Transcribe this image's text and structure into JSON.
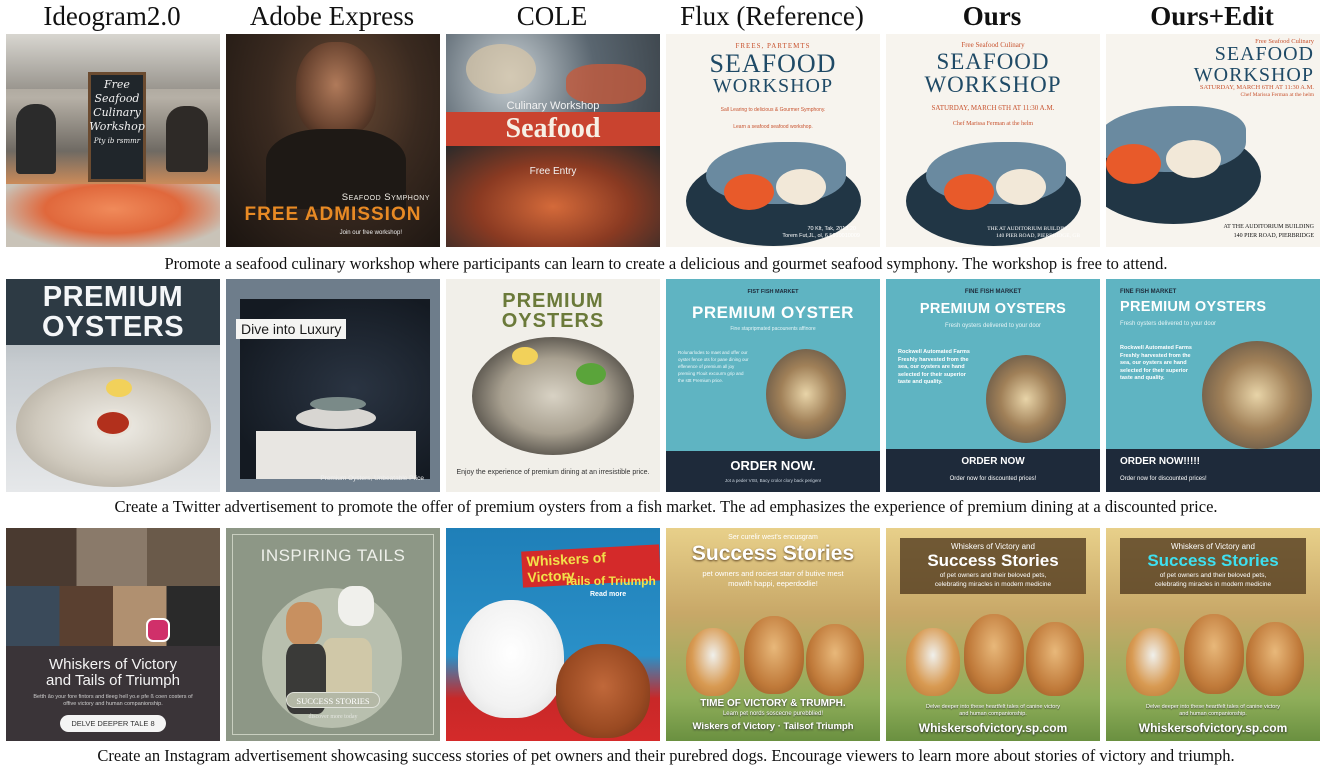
{
  "column_headers": [
    "Ideogram2.0",
    "Adobe Express",
    "COLE",
    "Flux (Reference)",
    "Ours",
    "Ours+Edit"
  ],
  "captions": [
    "Promote a seafood culinary workshop where participants can learn to create a delicious and gourmet seafood symphony. The workshop is free to attend.",
    "Create a Twitter advertisement to promote the offer of premium oysters from a fish market. The ad emphasizes the experience of premium dining at a discounted price.",
    "Create an Instagram advertisement showcasing success stories of pet owners and their purebred dogs. Encourage viewers to learn more about stories of victory and triumph."
  ],
  "row1": {
    "ideogram": {
      "line1": "Free",
      "line2": "Seafood",
      "line3": "Culinary",
      "line4": "Workshop",
      "line5": "Pty ib rsmmr"
    },
    "adobe": {
      "subtitle": "Seafood Symphony",
      "title": "FREE ADMISSION",
      "footer": "Join our free workshop!"
    },
    "cole": {
      "top": "Culinary Workshop",
      "title": "Seafood",
      "sub": "Free Entry"
    },
    "flux": {
      "top": "FREES, PARTEMTS",
      "title1": "SEAFOOD",
      "title2": "WORKSHOP",
      "line1": "Sall Learing to delicious & Gourmer Symphony.",
      "line2": "Learn a seafood seafood workshop.",
      "addr1": "70 Klt, Tak, 2013.20",
      "addr2": "Torem Fut,JL, ol, 6 5910010009"
    },
    "ours": {
      "top": "Free Seafood Culinary",
      "title1": "SEAFOOD",
      "title2": "WORKSHOP",
      "date": "Saturday, March 6th At 11:30 a.m.",
      "chef": "Chef Marissa Ferman at the helm",
      "addr1": "The at Auditorium Building",
      "addr2": "140 Pier Road, Pierbridge, GB"
    },
    "edit": {
      "top": "Free Seafood Culinary",
      "title1": "SEAFOOD",
      "title2": "WORKSHOP",
      "date": "Saturday, March 6th At 11:30 a.m.",
      "chef": "Chef Marissa Ferman at the helm",
      "addr1": "At the Auditorium Building",
      "addr2": "140 Pier Road, Pierbridge"
    }
  },
  "row2": {
    "ideogram": {
      "line1": "PREMIUM",
      "line2": "OYSTERS"
    },
    "adobe": {
      "title": "Dive into Luxury",
      "footer": "Premium Oysters, Unbeatable Price"
    },
    "cole": {
      "line1": "PREMIUM",
      "line2": "OYSTERS",
      "footer": "Enjoy the experience of premium dining at an irresistible price."
    },
    "flux": {
      "top": "FIST FISH MARKET",
      "title": "PREMIUM OYSTER",
      "sub": "Fine stapripmated pacounents affinore",
      "body": "Rolunarlodes to maet and offer our oyster fence ots for pane dining our effenence of premium all joy premiing Flouit excourm grip and the sttt Premium price.",
      "cta": "ORDER NOW.",
      "foot": "Jot a peder VISI, Bacy crolor clory back perigen!"
    },
    "ours": {
      "top": "FINE FISH MARKET",
      "title": "PREMIUM OYSTERS",
      "sub": "Fresh oysters delivered to your door",
      "body": "Rockwell Automated Farms Freshly harvested from the sea, our oysters are hand selected for their superior taste and quality.",
      "cta": "ORDER NOW",
      "foot": "Order now for discounted prices!"
    },
    "edit": {
      "top": "FINE FISH MARKET",
      "title": "PREMIUM OYSTERS",
      "sub": "Fresh oysters delivered to your door",
      "body": "Rockwell Automated Farms Freshly harvested from the sea, our oysters are hand selected for their superior taste and quality.",
      "cta": "ORDER NOW!!!!!",
      "foot": "Order now for discounted prices!"
    }
  },
  "row3": {
    "ideogram": {
      "title1": "Whiskers of Victory",
      "title2": "and Tails of Triumph",
      "body": "Betth ão your fore fintors and tleeg hell yo.e pfe ß coen costers of offive victory and human companionship.",
      "btn": "DELVE DEEPER TALE  8"
    },
    "adobe": {
      "title": "INSPIRING TAILS",
      "badge": "SUCCESS STORIES",
      "sub": "discover more today"
    },
    "cole": {
      "title": "Whiskers of Victory",
      "sub": "Tails of Triumph",
      "more": "Read more"
    },
    "flux": {
      "top": "Ser curelir west's encusgram",
      "title": "Success Stories",
      "sub": "pet owners and rociest starr of butive mest mowith happi, eeperdodlie!",
      "bottom1": "TIME OF VICTORY & TRUMPH.",
      "bottom2": "Leam pet nords soscecne purebblied!",
      "bottom3": "Wiskers of Victory · Tailsof Triumph"
    },
    "ours": {
      "top": "Whiskers of Victory and",
      "title": "Success Stories",
      "sub1": "of pet owners and their beloved pets,",
      "sub2": "celebrating miracles in modern medicine",
      "body": "Delve deeper into these heartfelt tales of canine victory and human companionship.",
      "url": "Whiskersofvictory.sp.com"
    },
    "edit": {
      "top": "Whiskers of Victory and",
      "title": "Success Stories",
      "sub1": "of pet owners and their beloved pets,",
      "sub2": "celebrating miracles in modern medicine",
      "body": "Delve deeper into these heartfelt tales of canine victory and human companionship.",
      "url": "Whiskersofvictory.sp.com"
    }
  }
}
